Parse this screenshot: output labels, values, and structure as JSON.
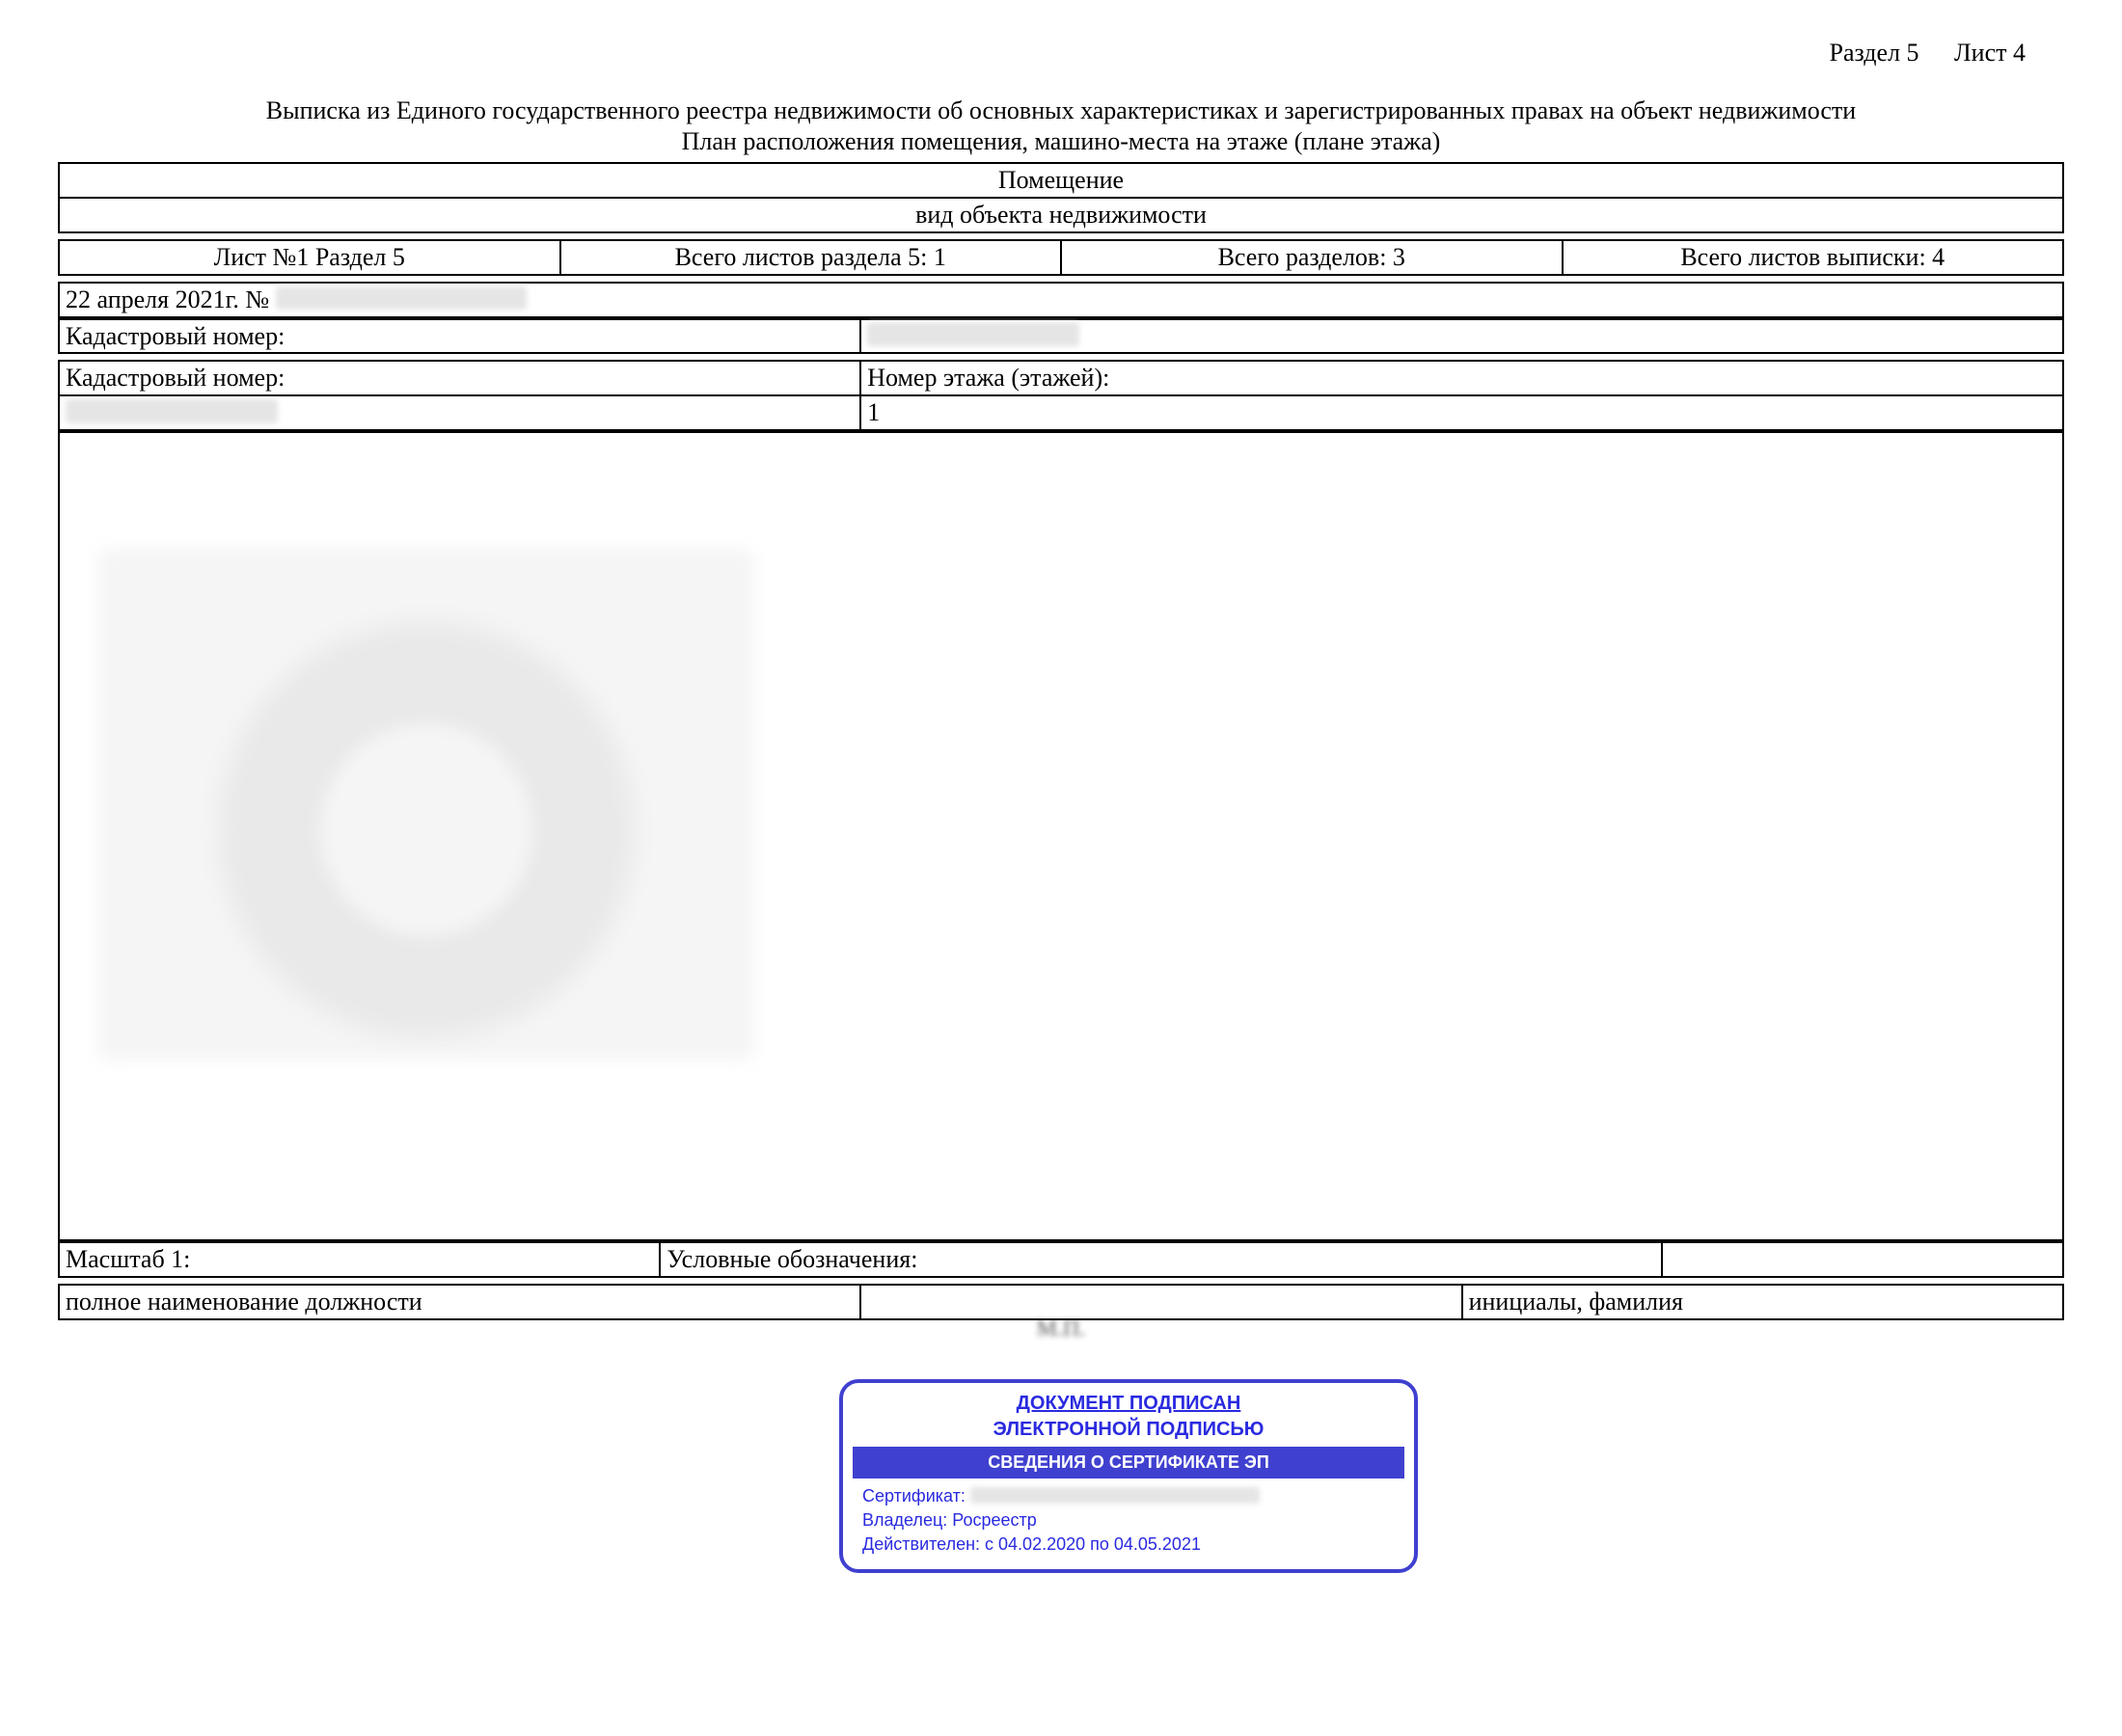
{
  "meta": {
    "section_label": "Раздел 5",
    "sheet_label": "Лист 4"
  },
  "title": "Выписка из Единого государственного реестра недвижимости об основных характеристиках и зарегистрированных правах на объект недвижимости",
  "subtitle": "План расположения помещения, машино-места на этаже (плане этажа)",
  "object": {
    "name": "Помещение",
    "kind_label": "вид объекта недвижимости"
  },
  "nav": {
    "sheet_section": "Лист №1  Раздел 5",
    "sheets_in_section": "Всего листов раздела 5: 1",
    "sections_total": "Всего разделов: 3",
    "sheets_total": "Всего листов выписки: 4"
  },
  "date_line": "22 апреля 2021г. № ",
  "cadastral_label": "Кадастровый номер:",
  "floor_label": "Номер этажа (этажей):",
  "floor_value": "1",
  "scale_label": "Масштаб 1:",
  "legend_label": "Условные обозначения:",
  "position_label": "полное наименование должности",
  "initials_label": "инициалы, фамилия",
  "mp": "М.П.",
  "stamp": {
    "head": "ДОКУМЕНТ ПОДПИСАН",
    "sub": "ЭЛЕКТРОННОЙ ПОДПИСЬЮ",
    "bar": "СВЕДЕНИЯ О СЕРТИФИКАТЕ ЭП",
    "cert_label": "Сертификат: ",
    "owner": "Владелец: Росреестр",
    "valid": "Действителен: с 04.02.2020 по 04.05.2021"
  }
}
